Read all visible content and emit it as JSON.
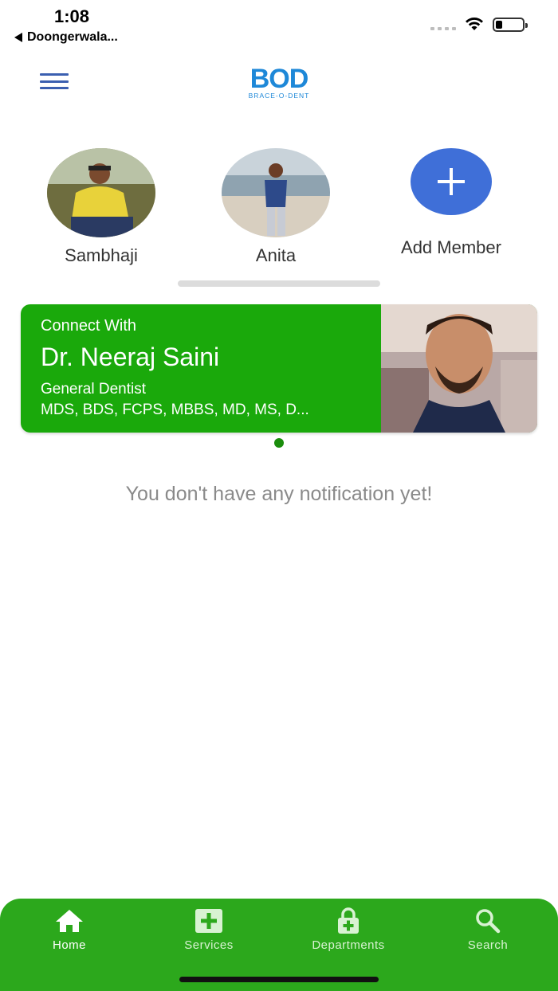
{
  "status_bar": {
    "time": "1:08",
    "back_app": "Doongerwala...",
    "battery_level": 0.25
  },
  "header": {
    "logo_text": "BOD",
    "logo_subtext": "BRACE-O-DENT"
  },
  "members": [
    {
      "name": "Sambhaji",
      "icon": "avatar-photo"
    },
    {
      "name": "Anita",
      "icon": "avatar-photo"
    }
  ],
  "add_member": {
    "label": "Add Member",
    "icon": "plus-icon"
  },
  "doctor_card": {
    "connect_label": "Connect With",
    "name": "Dr. Neeraj Saini",
    "specialty": "General Dentist",
    "qualifications": "MDS, BDS, FCPS, MBBS, MD, MS, D...",
    "color": "#1aa90b"
  },
  "notifications": {
    "empty_message": "You don't have any notification yet!"
  },
  "bottom_nav": {
    "items": [
      {
        "label": "Home",
        "icon": "home-icon",
        "active": true
      },
      {
        "label": "Services",
        "icon": "medical-plus-icon",
        "active": false
      },
      {
        "label": "Departments",
        "icon": "lock-plus-icon",
        "active": false
      },
      {
        "label": "Search",
        "icon": "search-icon",
        "active": false
      }
    ],
    "color": "#2ca81c"
  }
}
